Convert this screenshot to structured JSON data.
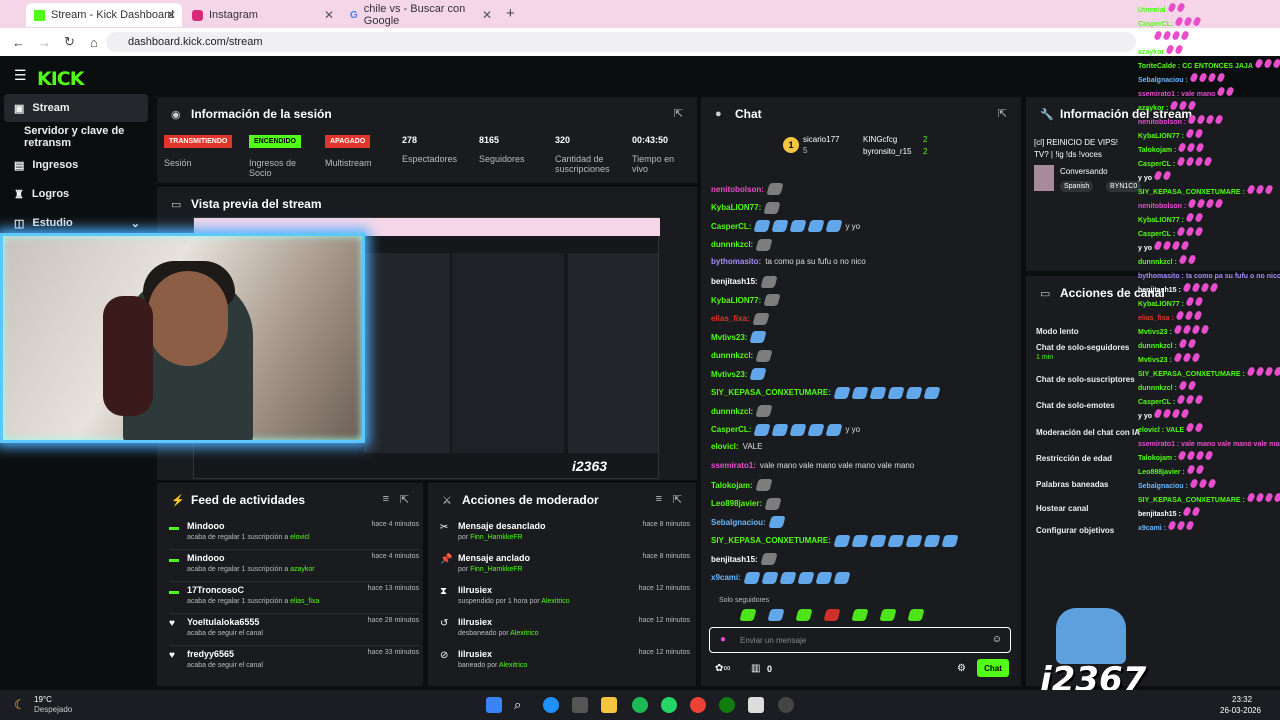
{
  "browser": {
    "tabs": [
      {
        "title": "Stream - Kick Dashboard",
        "active": true
      },
      {
        "title": "Instagram",
        "active": false
      },
      {
        "title": "chile vs - Buscar con Google",
        "active": false
      }
    ],
    "url": "dashboard.kick.com/stream"
  },
  "app": {
    "logo": "KICK"
  },
  "sidebar": {
    "items": [
      {
        "label": "Stream",
        "icon": "video-icon"
      },
      {
        "label": "Servidor y clave de retransm",
        "icon": ""
      },
      {
        "label": "Ingresos",
        "icon": "money-icon"
      },
      {
        "label": "Logros",
        "icon": "trophy-icon"
      },
      {
        "label": "Estudio",
        "icon": "studio-icon"
      }
    ]
  },
  "session": {
    "title": "Información de la sesión",
    "stats": [
      {
        "badge": "TRANSMITIENDO",
        "badge_color": "#e0352b",
        "label": "Sesión"
      },
      {
        "badge": "ENCENDIDO",
        "badge_color": "#53fc18",
        "label": "Ingresos de Socio"
      },
      {
        "badge": "APAGADO",
        "badge_color": "#e0352b",
        "label": "Multistream"
      },
      {
        "value": "278",
        "label": "Espectadores"
      },
      {
        "value": "8165",
        "label": "Seguidores"
      },
      {
        "value": "320",
        "label": "Cantidad de suscripciones"
      },
      {
        "value": "00:43:50",
        "label": "Tiempo en vivo"
      }
    ]
  },
  "preview": {
    "title": "Vista previa del stream"
  },
  "feed": {
    "title": "Feed de actividades",
    "rows": [
      {
        "name": "Mindooo",
        "desc": "acaba de regalar 1 suscripción a",
        "target": "elovicl",
        "time": "hace 4 minutos"
      },
      {
        "name": "Mindooo",
        "desc": "acaba de regalar 1 suscripción a",
        "target": "azaykor",
        "time": "hace 4 minutos"
      },
      {
        "name": "17TroncosoC",
        "desc": "acaba de regalar 1 suscripción a",
        "target": "elias_fixa",
        "time": "hace 13 minutos"
      },
      {
        "name": "Yoeltulaloka6555",
        "desc": "acaba de seguir el canal",
        "target": "",
        "time": "hace 28 minutos"
      },
      {
        "name": "fredyy6565",
        "desc": "acaba de seguir el canal",
        "target": "",
        "time": "hace 33 minutos"
      }
    ]
  },
  "mod": {
    "title": "Acciones de moderador",
    "rows": [
      {
        "name": "Mensaje desanclado",
        "desc": "por",
        "target": "Finn_HamkkeFR",
        "time": "hace 8 minutos"
      },
      {
        "name": "Mensaje anclado",
        "desc": "por",
        "target": "Finn_HamkkeFR",
        "time": "hace 8 minutos"
      },
      {
        "name": "lilrusiex",
        "desc": "suspendido por 1 hora por",
        "target": "Alexitrico",
        "time": "hace 12 minutos"
      },
      {
        "name": "lilrusiex",
        "desc": "desbaneado por",
        "target": "Alexitrico",
        "time": "hace 12 minutos"
      },
      {
        "name": "lilrusiex",
        "desc": "baneado por",
        "target": "Alexitrico",
        "time": "hace 12 minutos"
      }
    ]
  },
  "chat": {
    "title": "Chat",
    "top": {
      "first": "sicario177",
      "first_count": "5",
      "second": "KINGcfcg",
      "second_count": "2",
      "third": "byronsito_r15",
      "third_count": "2"
    },
    "messages": [
      {
        "user": "nenitobolson:",
        "color": "#e84dcc",
        "text": ""
      },
      {
        "user": "KybaLION77:",
        "color": "#53fc18",
        "text": ""
      },
      {
        "user": "CasperCL:",
        "color": "#53fc18",
        "text": "y yo",
        "emotes": 5
      },
      {
        "user": "dunnnkzcl:",
        "color": "#53fc18",
        "text": ""
      },
      {
        "user": "bythomasito:",
        "color": "#a78bfa",
        "text": "ta como pa su fufu o no nico"
      },
      {
        "user": "benjitash15:",
        "color": "#ffffff",
        "text": ""
      },
      {
        "user": "KybaLION77:",
        "color": "#53fc18",
        "text": ""
      },
      {
        "user": "elias_fixa:",
        "color": "#e0352b",
        "text": ""
      },
      {
        "user": "Mvtivs23:",
        "color": "#53fc18",
        "text": "",
        "emotes": 1
      },
      {
        "user": "dunnnkzcl:",
        "color": "#53fc18",
        "text": ""
      },
      {
        "user": "Mvtivs23:",
        "color": "#53fc18",
        "text": "",
        "emotes": 1
      },
      {
        "user": "SIY_KEPASA_CONXETUMARE:",
        "color": "#53fc18",
        "text": "",
        "emotes": 6
      },
      {
        "user": "dunnnkzcl:",
        "color": "#53fc18",
        "text": ""
      },
      {
        "user": "CasperCL:",
        "color": "#53fc18",
        "text": "y yo",
        "emotes": 5
      },
      {
        "user": "elovicl:",
        "color": "#53fc18",
        "text": "VALE"
      },
      {
        "user": "ssemirato1:",
        "color": "#e84dcc",
        "text": "vale mano vale mano vale mano vale mano"
      },
      {
        "user": "Talokojam:",
        "color": "#53fc18",
        "text": ""
      },
      {
        "user": "Leo898javier:",
        "color": "#53fc18",
        "text": ""
      },
      {
        "user": "Sebalgnaciou:",
        "color": "#6ab7ff",
        "text": "",
        "emotes": 1
      },
      {
        "user": "SIY_KEPASA_CONXETUMARE:",
        "color": "#53fc18",
        "text": "",
        "emotes": 7
      },
      {
        "user": "benjitash15:",
        "color": "#ffffff",
        "text": ""
      },
      {
        "user": "x9cami:",
        "color": "#6ab7ff",
        "text": "",
        "emotes": 6
      }
    ],
    "mode": "Solo seguidores",
    "input_placeholder": "Enviar un mensaje",
    "send_label": "Chat",
    "count": "0",
    "accent": "#53fc18"
  },
  "info": {
    "title": "Información del stream",
    "stream_title": "[cl] REINICIO DE VIPS! TV? | !ig !ds !voces",
    "category": "Conversando",
    "tags": [
      "Spanish",
      "BYN1C0"
    ]
  },
  "channel": {
    "title": "Acciones de canal",
    "items": [
      "Modo lento",
      "Chat de solo-seguidores",
      "Chat de solo-suscriptores",
      "Chat de solo-emotes",
      "Moderación del chat con IA",
      "Restricción de edad",
      "Palabras baneadas",
      "Hostear canal",
      "Configurar objetivos"
    ],
    "sub": "1 min"
  },
  "overlay": {
    "lines": [
      {
        "u": "Utnenial",
        "c": "#53fc18"
      },
      {
        "u": "CasperCL:",
        "c": "#53fc18"
      },
      {
        "u": "y yo",
        "c": "#fff"
      },
      {
        "u": "azaykor",
        "c": "#53fc18"
      },
      {
        "u": "ToriteCalde : CC ENTONCES JAJA",
        "c": "#53fc18"
      },
      {
        "u": "Sebalgnaciou :",
        "c": "#6ab7ff"
      },
      {
        "u": "ssemirato1 : vale mano",
        "c": "#e84dcc"
      },
      {
        "u": "azaykor :",
        "c": "#53fc18"
      },
      {
        "u": "nenitobolson :",
        "c": "#e84dcc"
      },
      {
        "u": "KybaLION77 :",
        "c": "#53fc18"
      },
      {
        "u": "Talokojam :",
        "c": "#53fc18"
      },
      {
        "u": "CasperCL :",
        "c": "#53fc18"
      },
      {
        "u": "y yo",
        "c": "#fff"
      },
      {
        "u": "SIY_KEPASA_CONXETUMARE :",
        "c": "#53fc18"
      },
      {
        "u": "nenitobolson :",
        "c": "#e84dcc"
      },
      {
        "u": "KybaLION77 :",
        "c": "#53fc18"
      },
      {
        "u": "CasperCL :",
        "c": "#53fc18"
      },
      {
        "u": "y yo",
        "c": "#fff"
      },
      {
        "u": "dunnnkzcl :",
        "c": "#53fc18"
      },
      {
        "u": "bythomasito : ta como pa su fufu o no nico",
        "c": "#a78bfa"
      },
      {
        "u": "benjitash15 :",
        "c": "#fff"
      },
      {
        "u": "KybaLION77 :",
        "c": "#53fc18"
      },
      {
        "u": "elias_fixa :",
        "c": "#e0352b"
      },
      {
        "u": "Mvtivs23 :",
        "c": "#53fc18"
      },
      {
        "u": "dunnnkzcl :",
        "c": "#53fc18"
      },
      {
        "u": "Mvtivs23 :",
        "c": "#53fc18"
      },
      {
        "u": "SIY_KEPASA_CONXETUMARE :",
        "c": "#53fc18"
      },
      {
        "u": "dunnnkzcl :",
        "c": "#53fc18"
      },
      {
        "u": "CasperCL :",
        "c": "#53fc18"
      },
      {
        "u": "y yo",
        "c": "#fff"
      },
      {
        "u": "elovicl : VALE",
        "c": "#53fc18"
      },
      {
        "u": "ssemirato1 : vale mano vale mano vale mano",
        "c": "#e84dcc"
      },
      {
        "u": "Talokojam :",
        "c": "#53fc18"
      },
      {
        "u": "Leo898javier :",
        "c": "#53fc18"
      },
      {
        "u": "Sebalgnaciou :",
        "c": "#6ab7ff"
      },
      {
        "u": "SIY_KEPASA_CONXETUMARE :",
        "c": "#53fc18"
      },
      {
        "u": "benjitash15 :",
        "c": "#fff"
      },
      {
        "u": "x9cami :",
        "c": "#6ab7ff"
      }
    ],
    "sub_number": "i2367",
    "preview_number": "i2363"
  },
  "system": {
    "weather_temp": "19°C",
    "weather_desc": "Despejado",
    "time": "23:32",
    "date": "26-03-2026"
  }
}
